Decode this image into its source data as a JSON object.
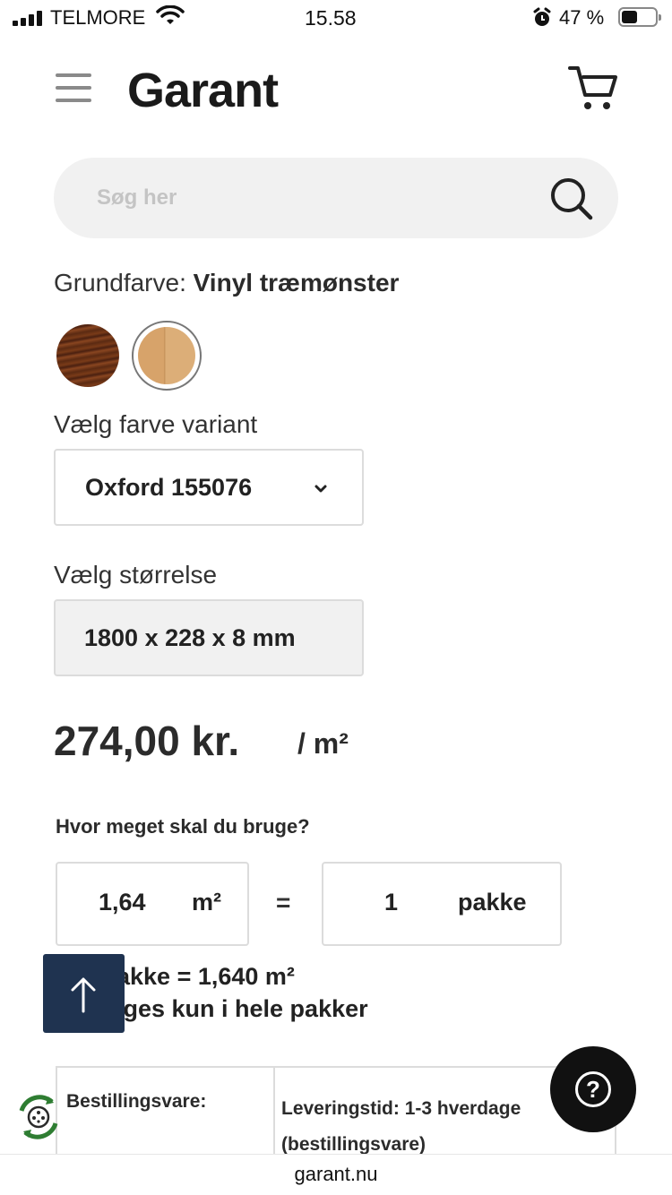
{
  "status_bar": {
    "carrier": "TELMORE",
    "time": "15.58",
    "battery_percent": "47 %",
    "battery_level": 0.47
  },
  "header": {
    "logo_text": "Garant",
    "menu_icon": "hamburger-icon",
    "cart_icon": "cart-icon"
  },
  "search": {
    "placeholder": "Søg her",
    "icon": "search-icon"
  },
  "product": {
    "base_color_label": "Grundfarve:",
    "base_color_value": "Vinyl træmønster",
    "swatches": [
      {
        "name": "dark-wood",
        "color": "#6b3417",
        "selected": false
      },
      {
        "name": "light-wood",
        "color": "#d7a36a",
        "selected": true
      }
    ],
    "variant_label": "Vælg farve variant",
    "variant_value": "Oxford 155076",
    "size_label": "Vælg størrelse",
    "size_value": "1800 x 228 x 8 mm",
    "price": "274,00 kr.",
    "price_unit": "/ m²"
  },
  "calculator": {
    "question": "Hvor meget skal du bruge?",
    "area_value": "1,64",
    "area_unit": "m²",
    "equals": "=",
    "pack_value": "1",
    "pack_unit": "pakke",
    "pack_info_line1": "akke = 1,640 m²",
    "pack_info_line2": "lges kun i hele pakker"
  },
  "delivery": {
    "left": "Bestillingsvare:",
    "right": "Leveringstid: 1-3 hverdage (bestillingsvare)"
  },
  "floating": {
    "scroll_top_icon": "arrow-up-icon",
    "help_label": "?",
    "recycle_icon": "recycle-icon",
    "accent_dark_blue": "#1f3350"
  },
  "browser": {
    "url": "garant.nu"
  }
}
